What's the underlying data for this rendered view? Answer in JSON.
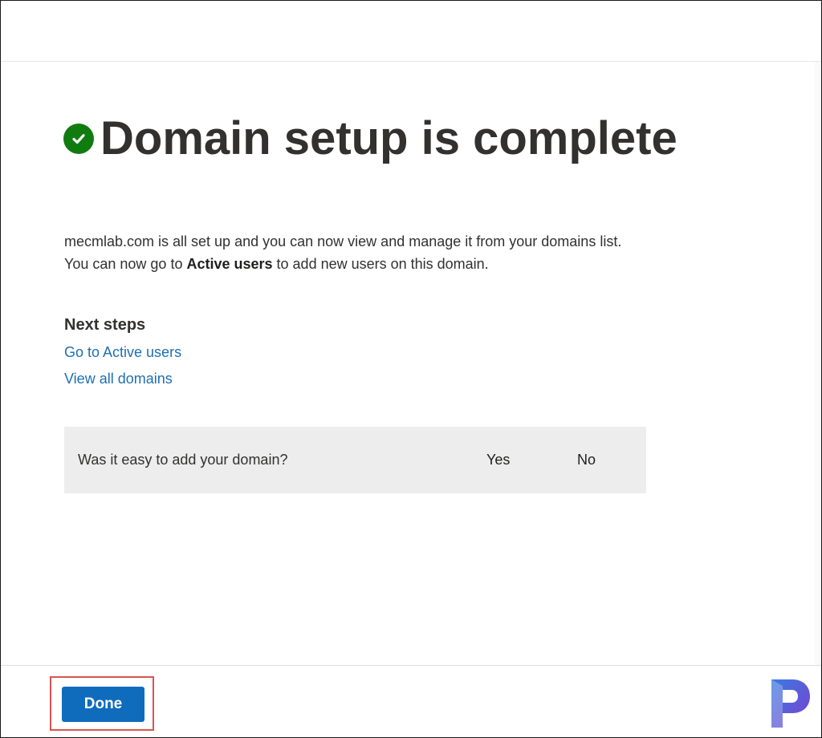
{
  "header": {
    "title": "Domain setup is complete",
    "icon": "check-circle-icon",
    "icon_color": "#107c10"
  },
  "description": {
    "line1": "mecmlab.com is all set up and you can now view and manage it from your domains list.",
    "line2_prefix": "You can now go to ",
    "line2_bold": "Active users",
    "line2_suffix": " to add new users on this domain."
  },
  "next_steps": {
    "title": "Next steps",
    "links": [
      {
        "label": "Go to Active users"
      },
      {
        "label": "View all domains"
      }
    ]
  },
  "feedback": {
    "question": "Was it easy to add your domain?",
    "yes_label": "Yes",
    "no_label": "No"
  },
  "footer": {
    "done_label": "Done",
    "highlight_color": "#d9534f",
    "button_color": "#0f6cbd"
  },
  "watermark": {
    "icon": "p-logo-icon",
    "letter": "P"
  }
}
